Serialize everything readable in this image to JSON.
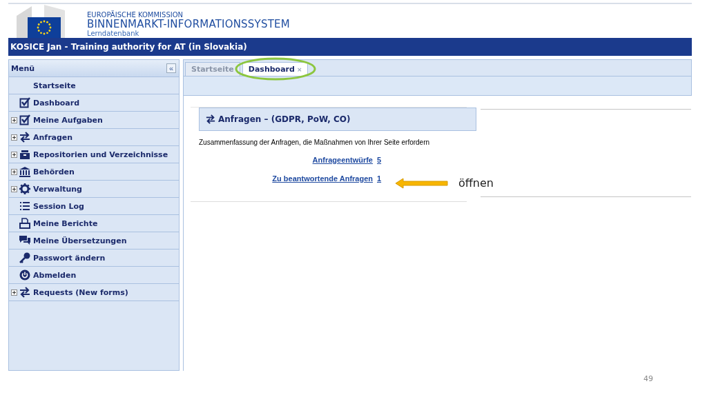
{
  "header": {
    "organization": "EUROPÄISCHE KOMMISSION",
    "system": "BINNENMARKT-INFORMATIONSSYSTEM",
    "subtitle": "Lerndatenbank"
  },
  "user_bar": {
    "text": "KOSICE Jan - Training authority for AT (in Slovakia)"
  },
  "sidebar": {
    "title": "Menü",
    "collapse": "«",
    "items": [
      {
        "label": "Startseite",
        "expandable": false
      },
      {
        "label": "Dashboard",
        "expandable": false
      },
      {
        "label": "Meine Aufgaben",
        "expandable": true
      },
      {
        "label": "Anfragen",
        "expandable": true
      },
      {
        "label": "Repositorien und Verzeichnisse",
        "expandable": true
      },
      {
        "label": "Behörden",
        "expandable": true
      },
      {
        "label": "Verwaltung",
        "expandable": true
      },
      {
        "label": "Session Log",
        "expandable": false
      },
      {
        "label": "Meine Berichte",
        "expandable": false
      },
      {
        "label": "Meine Übersetzungen",
        "expandable": false
      },
      {
        "label": "Passwort ändern",
        "expandable": false
      },
      {
        "label": "Abmelden",
        "expandable": false
      },
      {
        "label": "Requests (New forms)",
        "expandable": true
      }
    ]
  },
  "tabs": [
    {
      "label": "Startseite",
      "selected": false
    },
    {
      "label": "Dashboard",
      "selected": true,
      "close": "×"
    }
  ],
  "panel": {
    "title": "Anfragen – (GDPR, PoW, CO)",
    "description": "Zusammenfassung der Anfragen, die Maßnahmen von Ihrer Seite erfordern",
    "rows": [
      {
        "label": "Anfrageentwürfe",
        "count": "5"
      },
      {
        "label": "Zu beantwortende Anfragen",
        "count": "1"
      }
    ]
  },
  "annotation": {
    "text": "öffnen"
  },
  "slide_number": "49"
}
